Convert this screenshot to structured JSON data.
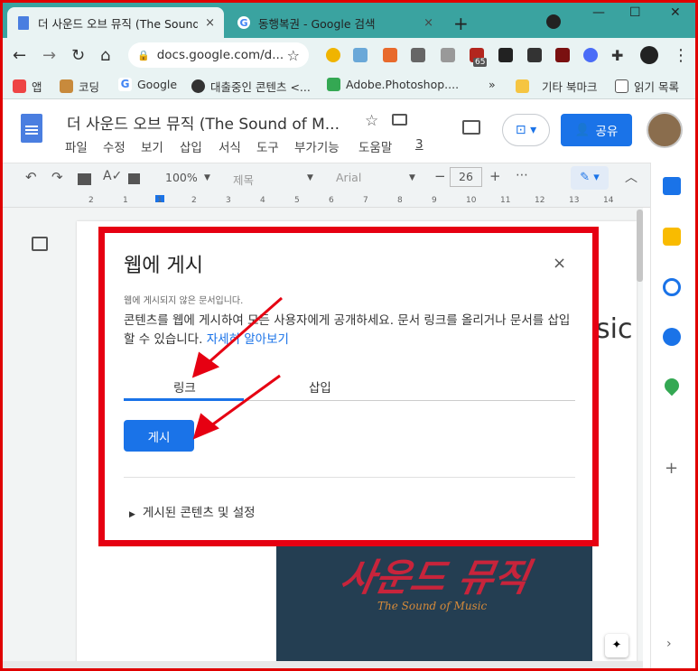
{
  "browser": {
    "tabs": [
      {
        "title": "더 사운드 오브 뮤직 (The Sound of Music)",
        "active": true,
        "close": "×"
      },
      {
        "title": "동행복권 - Google 검색",
        "active": false,
        "close": "×"
      }
    ],
    "new_tab": "+",
    "window_controls": {
      "minimize": "—",
      "maximize": "☐",
      "close": "✕"
    },
    "address": "docs.google.com/d...",
    "bookmarks": [
      "앱",
      "코딩",
      "Google",
      "대출중인 콘텐츠 <...",
      "Adobe.Photoshop....",
      "기타 북마크",
      "읽기 목록"
    ],
    "bookmarks_more": "»",
    "ext_badge": "65"
  },
  "docs": {
    "title": "더 사운드 오브 뮤직 (The Sound of M...",
    "menu": [
      "파일",
      "수정",
      "보기",
      "삽입",
      "서식",
      "도구",
      "부가기능",
      "도움말",
      "3"
    ],
    "share_label": "공유",
    "toolbar": {
      "zoom": "100%",
      "style": "제목",
      "font": "Arial",
      "size": "26",
      "more": "⋯"
    },
    "ruler_marks": [
      "2",
      "1",
      "1",
      "2",
      "3",
      "4",
      "5",
      "6",
      "7",
      "8",
      "9",
      "10",
      "11",
      "12",
      "13",
      "14"
    ],
    "music_text": "sic",
    "cover": {
      "title": "사운드 뮤직",
      "subtitle": "The Sound of Music"
    }
  },
  "dialog": {
    "title": "웹에 게시",
    "close": "×",
    "status": "웹에 게시되지 않은 문서입니다.",
    "description": "콘텐츠를 웹에 게시하여 모든 사용자에게 공개하세요. 문서 링크를 올리거나 문서를 삽입할 수 있습니다.",
    "learn_more": "자세히 알아보기",
    "tab_link": "링크",
    "tab_embed": "삽입",
    "publish_button": "게시",
    "expander": "게시된 콘텐츠 및 설정"
  },
  "colors": {
    "accent": "#1a73e8",
    "highlight_box": "#e60012",
    "tabstrip": "#3aa3a0"
  }
}
